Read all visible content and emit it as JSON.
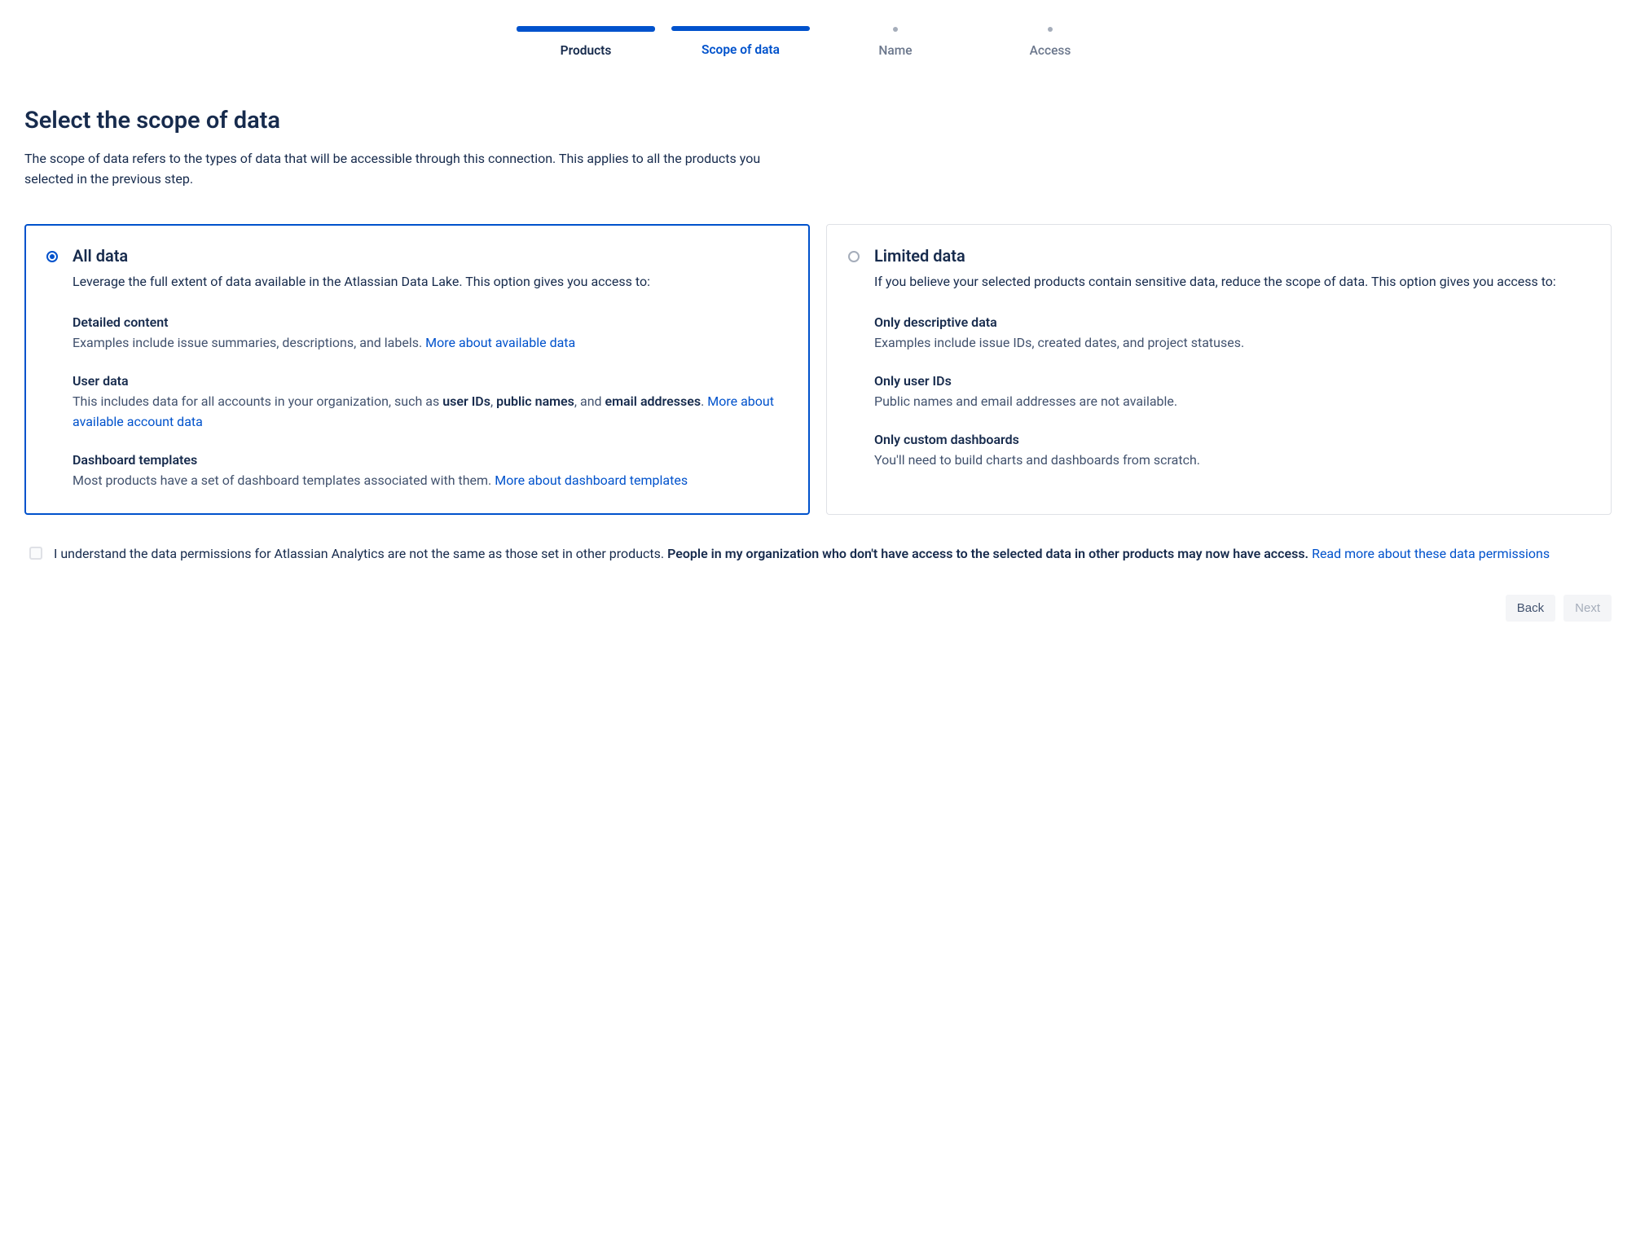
{
  "stepper": {
    "steps": [
      {
        "label": "Products",
        "state": "completed"
      },
      {
        "label": "Scope of data",
        "state": "active"
      },
      {
        "label": "Name",
        "state": "upcoming"
      },
      {
        "label": "Access",
        "state": "upcoming"
      }
    ]
  },
  "page": {
    "title": "Select the scope of data",
    "description": "The scope of data refers to the types of data that will be accessible through this connection. This applies to all the products you selected in the previous step."
  },
  "options": {
    "all": {
      "title": "All data",
      "description": "Leverage the full extent of data available in the Atlassian Data Lake. This option gives you access to:",
      "features": [
        {
          "title": "Detailed content",
          "text": "Examples include issue summaries, descriptions, and labels. ",
          "link": "More about available data"
        },
        {
          "title": "User data",
          "text_pre": "This includes data for all accounts in your organization, such as ",
          "bold1": "user IDs",
          "sep1": ", ",
          "bold2": "public names",
          "sep2": ", and ",
          "bold3": "email addresses",
          "tail": ". ",
          "link": "More about available account data"
        },
        {
          "title": "Dashboard templates",
          "text": "Most products have a set of dashboard templates associated with them. ",
          "link": "More about dashboard templates"
        }
      ]
    },
    "limited": {
      "title": "Limited data",
      "description": "If you believe your selected products contain sensitive data, reduce the scope of data. This option gives you access to:",
      "features": [
        {
          "title": "Only descriptive data",
          "text": "Examples include issue IDs, created dates, and project statuses."
        },
        {
          "title": "Only user IDs",
          "text": "Public names and email addresses are not available."
        },
        {
          "title": "Only custom dashboards",
          "text": "You'll need to build charts and dashboards from scratch."
        }
      ]
    }
  },
  "consent": {
    "text_pre": "I understand the data permissions for Atlassian Analytics are not the same as those set in other products. ",
    "bold": "People in my organization who don't have access to the selected data in other products may now have access.",
    "sep": " ",
    "link": "Read more about these data permissions"
  },
  "actions": {
    "back": "Back",
    "next": "Next"
  }
}
